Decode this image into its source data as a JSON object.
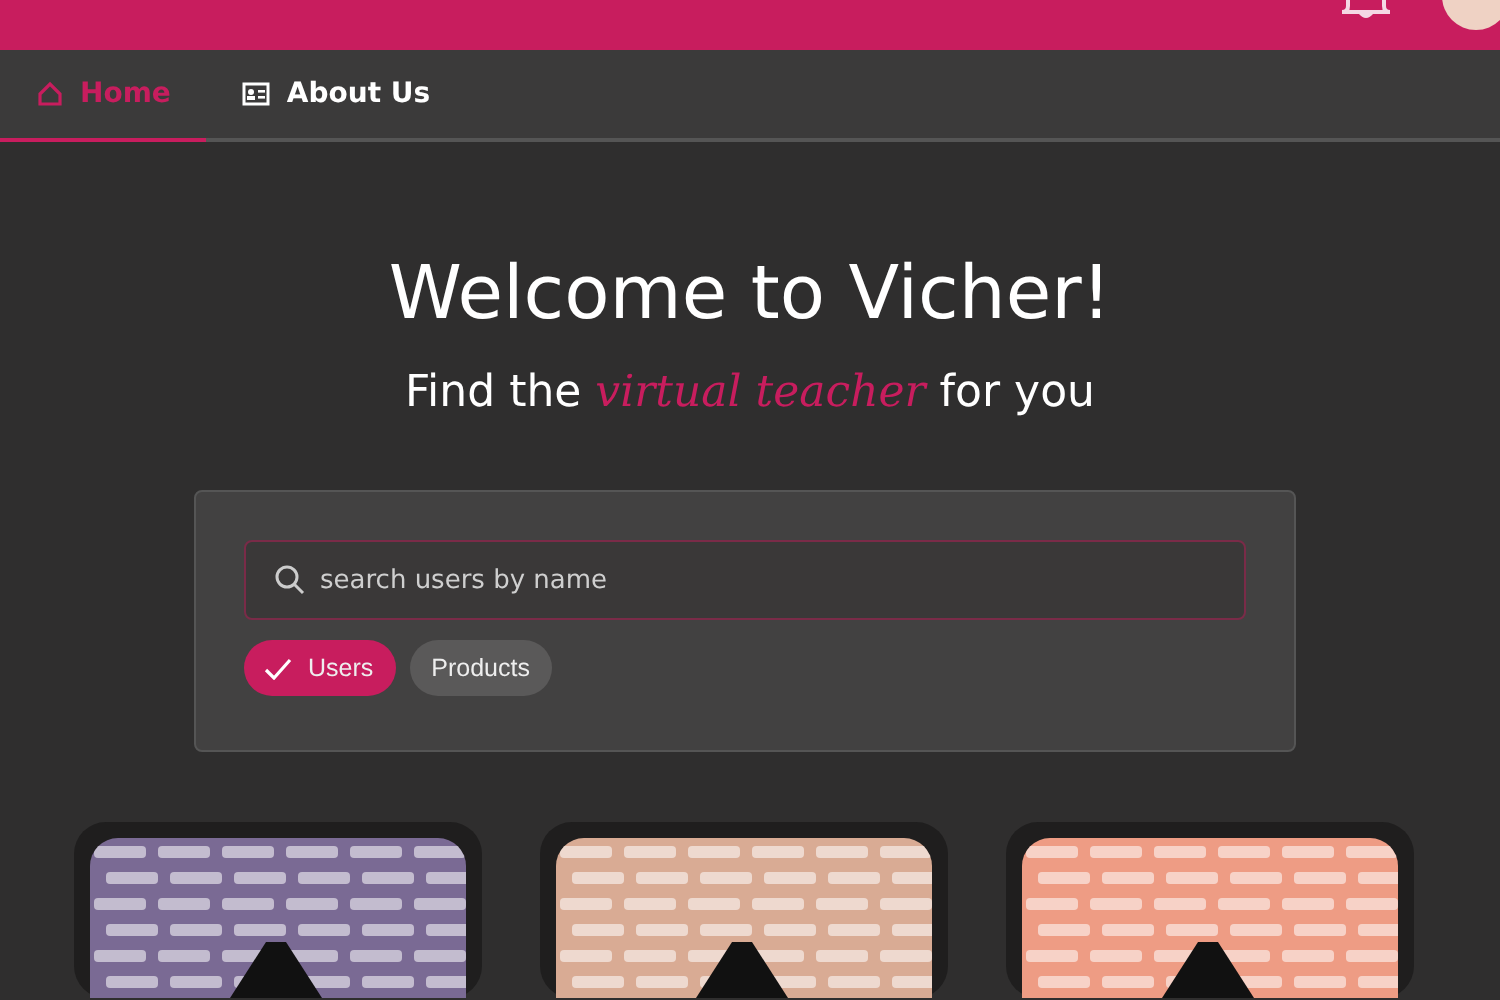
{
  "nav": {
    "tabs": [
      {
        "label": "Home",
        "kind": "home",
        "selected": true
      },
      {
        "label": "About Us",
        "kind": "about",
        "selected": false
      }
    ]
  },
  "hero": {
    "title": "Welcome to Vicher!",
    "subtitle": "Find the *virtual teacher* for you"
  },
  "search": {
    "placeholder": "search users by name",
    "filters": [
      {
        "label": "Users",
        "selected": true
      },
      {
        "label": "Products",
        "selected": false
      }
    ]
  }
}
